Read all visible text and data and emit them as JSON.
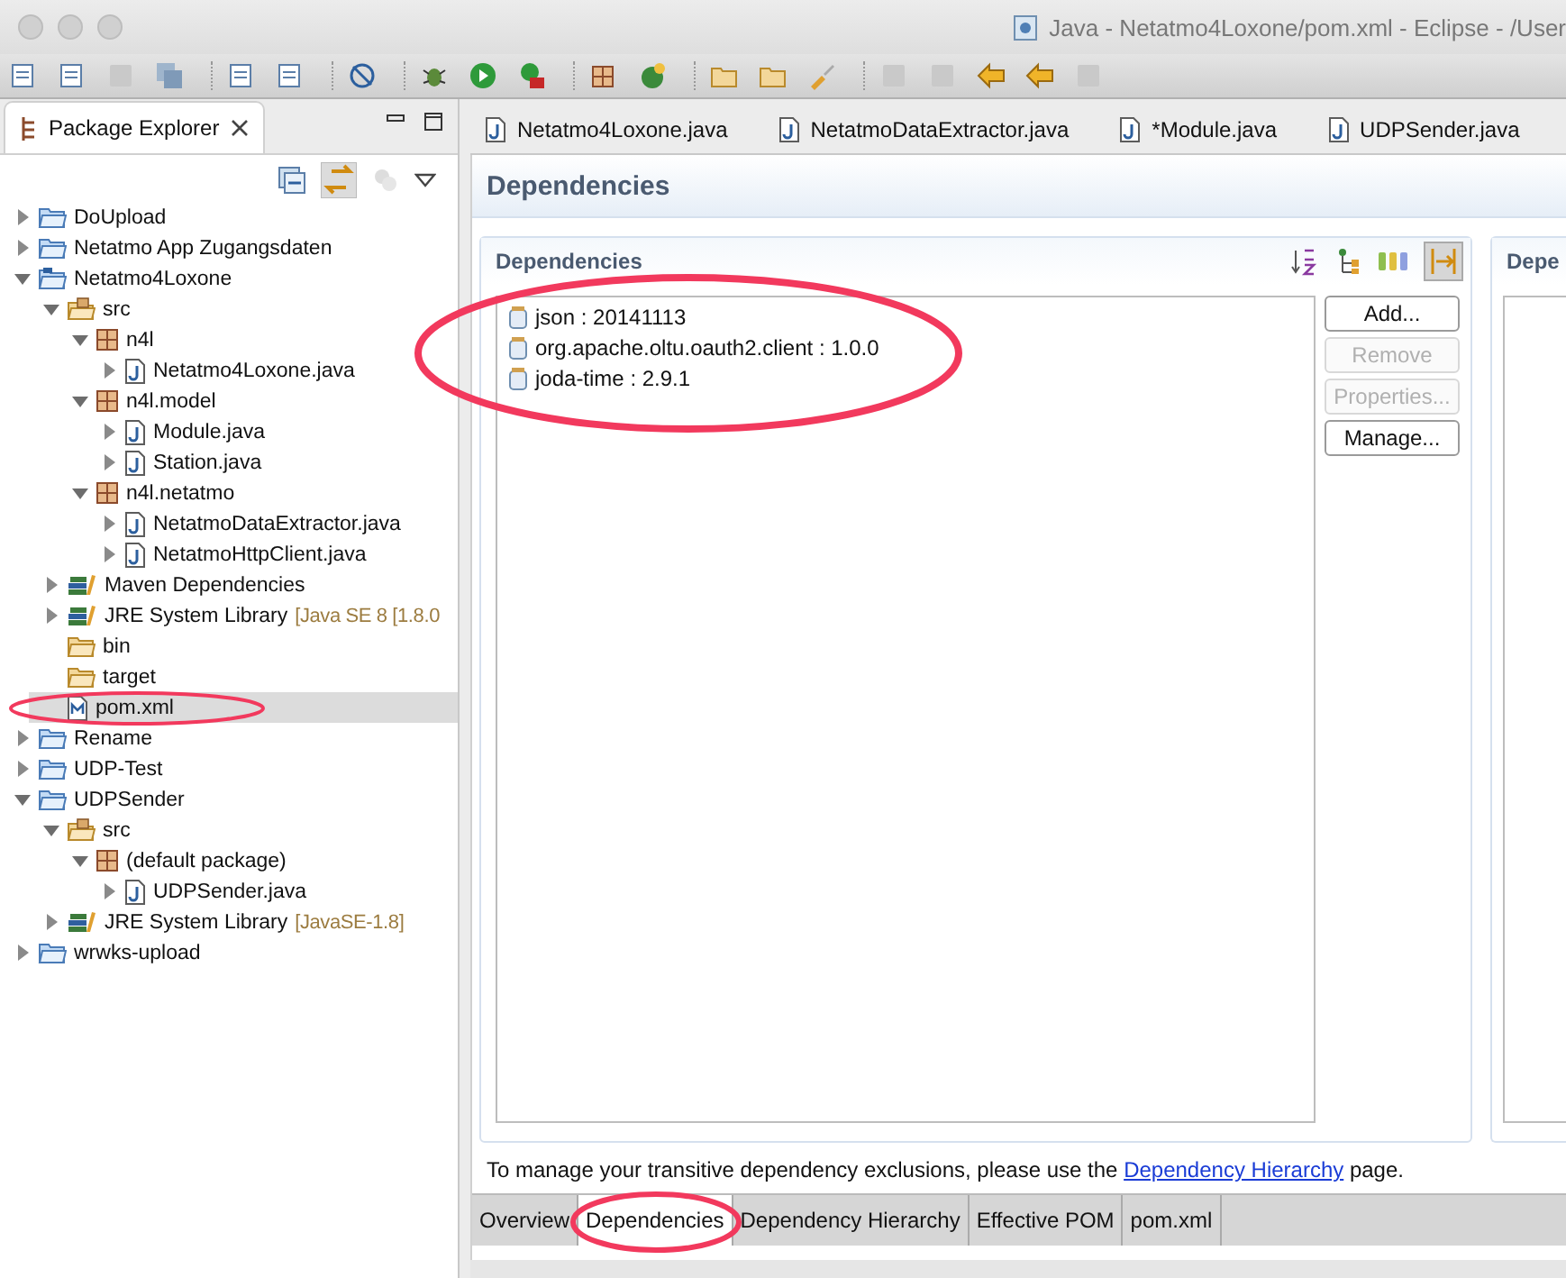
{
  "window": {
    "title": "Java - Netatmo4Loxone/pom.xml - Eclipse - /User"
  },
  "explorer": {
    "title": "Package Explorer",
    "tree": [
      {
        "label": "DoUpload",
        "kind": "project",
        "expanded": false,
        "selected": false
      },
      {
        "label": "Netatmo App Zugangsdaten",
        "kind": "project",
        "expanded": false,
        "selected": false
      },
      {
        "label": "Netatmo4Loxone",
        "kind": "maven-project",
        "expanded": true,
        "selected": false,
        "children": [
          {
            "label": "src",
            "kind": "source-folder",
            "expanded": true,
            "selected": false,
            "children": [
              {
                "label": "n4l",
                "kind": "package",
                "expanded": true,
                "selected": false,
                "children": [
                  {
                    "label": "Netatmo4Loxone.java",
                    "kind": "java",
                    "expanded": false,
                    "selected": false
                  }
                ]
              },
              {
                "label": "n4l.model",
                "kind": "package",
                "expanded": true,
                "selected": false,
                "children": [
                  {
                    "label": "Module.java",
                    "kind": "java",
                    "expanded": false,
                    "selected": false
                  },
                  {
                    "label": "Station.java",
                    "kind": "java",
                    "expanded": false,
                    "selected": false
                  }
                ]
              },
              {
                "label": "n4l.netatmo",
                "kind": "package",
                "expanded": true,
                "selected": false,
                "children": [
                  {
                    "label": "NetatmoDataExtractor.java",
                    "kind": "java",
                    "expanded": false,
                    "selected": false
                  },
                  {
                    "label": "NetatmoHttpClient.java",
                    "kind": "java",
                    "expanded": false,
                    "selected": false
                  }
                ]
              }
            ]
          },
          {
            "label": "Maven Dependencies",
            "kind": "library",
            "expanded": false,
            "selected": false
          },
          {
            "label": "JRE System Library",
            "decoration": "[Java SE 8 [1.8.0",
            "kind": "library",
            "expanded": false,
            "selected": false
          },
          {
            "label": "bin",
            "kind": "folder",
            "selected": false
          },
          {
            "label": "target",
            "kind": "folder",
            "selected": false
          },
          {
            "label": "pom.xml",
            "kind": "pom",
            "selected": true
          }
        ]
      },
      {
        "label": "Rename",
        "kind": "project",
        "expanded": false,
        "selected": false
      },
      {
        "label": "UDP-Test",
        "kind": "project",
        "expanded": false,
        "selected": false
      },
      {
        "label": "UDPSender",
        "kind": "project",
        "expanded": true,
        "selected": false,
        "children": [
          {
            "label": "src",
            "kind": "source-folder",
            "expanded": true,
            "selected": false,
            "children": [
              {
                "label": "(default package)",
                "kind": "package",
                "expanded": true,
                "selected": false,
                "children": [
                  {
                    "label": "UDPSender.java",
                    "kind": "java",
                    "expanded": false,
                    "selected": false
                  }
                ]
              }
            ]
          },
          {
            "label": "JRE System Library",
            "decoration": "[JavaSE-1.8]",
            "kind": "library",
            "expanded": false,
            "selected": false
          }
        ]
      },
      {
        "label": "wrwks-upload",
        "kind": "project",
        "expanded": false,
        "selected": false
      }
    ]
  },
  "editor_tabs": [
    {
      "label": "Netatmo4Loxone.java",
      "selected": false
    },
    {
      "label": "NetatmoDataExtractor.java",
      "selected": false
    },
    {
      "label": "*Module.java",
      "selected": false
    },
    {
      "label": "UDPSender.java",
      "selected": false
    }
  ],
  "page": {
    "title": "Dependencies",
    "section": {
      "title": "Dependencies",
      "toggle_pressed": true,
      "items": [
        "json : 20141113",
        "org.apache.oltu.oauth2.client : 1.0.0",
        "joda-time : 2.9.1"
      ],
      "buttons": [
        {
          "label": "Add...",
          "disabled": false
        },
        {
          "label": "Remove",
          "disabled": true
        },
        {
          "label": "Properties...",
          "disabled": true
        },
        {
          "label": "Manage...",
          "disabled": false
        }
      ]
    },
    "side_section": {
      "title": "Depe"
    },
    "footer": {
      "before": "To manage your transitive dependency exclusions, please use the ",
      "link": "Dependency Hierarchy",
      "after": " page."
    }
  },
  "bottom_tabs": [
    {
      "label": "Overview",
      "selected": false
    },
    {
      "label": "Dependencies",
      "selected": true
    },
    {
      "label": "Dependency Hierarchy",
      "selected": false
    },
    {
      "label": "Effective POM",
      "selected": false
    },
    {
      "label": "pom.xml",
      "selected": false
    }
  ]
}
